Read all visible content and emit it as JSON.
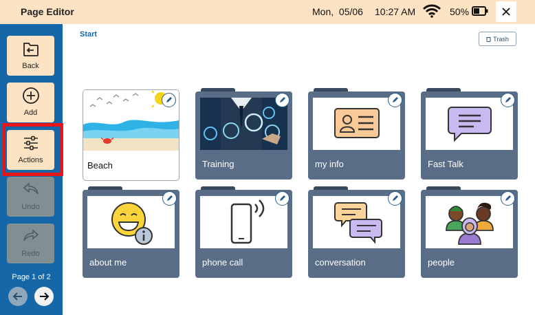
{
  "topbar": {
    "title": "Page Editor",
    "date": "Mon,  05/06",
    "time": "10:27 AM",
    "battery": "50%"
  },
  "sidebar": {
    "buttons": [
      {
        "label": "Back",
        "icon": "back-folder-icon",
        "enabled": true
      },
      {
        "label": "Add",
        "icon": "plus-circle-icon",
        "enabled": true
      },
      {
        "label": "Actions",
        "icon": "sliders-icon",
        "enabled": true,
        "highlighted": true
      },
      {
        "label": "Undo",
        "icon": "undo-arrow-icon",
        "enabled": false
      },
      {
        "label": "Redo",
        "icon": "redo-arrow-icon",
        "enabled": false
      }
    ],
    "page_indicator": "Page 1 of 2"
  },
  "content": {
    "breadcrumb": "Start",
    "trash_label": "Trash",
    "tiles": [
      {
        "label": "Beach",
        "icon": "beach-scene-icon"
      },
      {
        "label": "Training",
        "icon": "training-photo"
      },
      {
        "label": "my info",
        "icon": "id-card-icon"
      },
      {
        "label": "Fast Talk",
        "icon": "speech-bubble-icon"
      },
      {
        "label": "about me",
        "icon": "smiley-info-icon"
      },
      {
        "label": "phone call",
        "icon": "phone-icon"
      },
      {
        "label": "conversation",
        "icon": "conversation-bubbles-icon"
      },
      {
        "label": "people",
        "icon": "people-group-icon"
      }
    ]
  },
  "colors": {
    "topbar": "#fde3c3",
    "sidebar": "#1667a8",
    "folder": "#5a6d86",
    "highlight": "#e81416"
  }
}
